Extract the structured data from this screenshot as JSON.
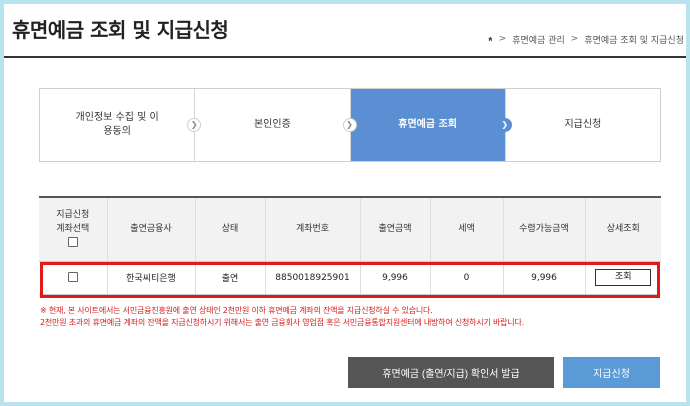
{
  "header": {
    "title": "휴면예금 조회 및 지급신청",
    "breadcrumb": [
      "휴면예금 관리",
      "휴면예금 조회 및 지급신청"
    ]
  },
  "steps": [
    {
      "label": "개인정보 수집 및 이용동의",
      "active": false
    },
    {
      "label": "본인인증",
      "active": false
    },
    {
      "label": "휴면예금 조회",
      "active": true
    },
    {
      "label": "지급신청",
      "active": false
    }
  ],
  "table": {
    "headers": {
      "select_line1": "지급신청",
      "select_line2": "계좌선택",
      "institution": "출연금융사",
      "status": "상태",
      "account": "계좌번호",
      "amount": "출연금액",
      "tax": "세액",
      "receivable": "수령가능금액",
      "detail": "상세조회"
    },
    "rows": [
      {
        "institution": "한국씨티은행",
        "status": "출연",
        "account": "8850018925901",
        "amount": "9,996",
        "tax": "0",
        "receivable": "9,996",
        "detail_button": "조회"
      }
    ]
  },
  "notice": {
    "line1": "※ 현재, 본 사이트에서는 서민금융진흥원에 출연 상태인 2천만원 이하 휴면예금 계좌의 잔액을 지급신청하실 수 있습니다.",
    "line2": "2천만원 초과의 휴면예금 계좌의 잔액을 지급신청하시기 위해서는 출연 금융회사 영업점 혹은 서민금융통합지원센터에 내방하여 신청하시기 바랍니다."
  },
  "buttons": {
    "certificate": "휴면예금 (출연/지급) 확인서 발급",
    "apply": "지급신청"
  },
  "colors": {
    "active_step": "#5a8fd3",
    "highlight": "#e01a1a",
    "notice_text": "#d81b1b",
    "dark_button": "#555555",
    "blue_button": "#5a9ad6"
  }
}
